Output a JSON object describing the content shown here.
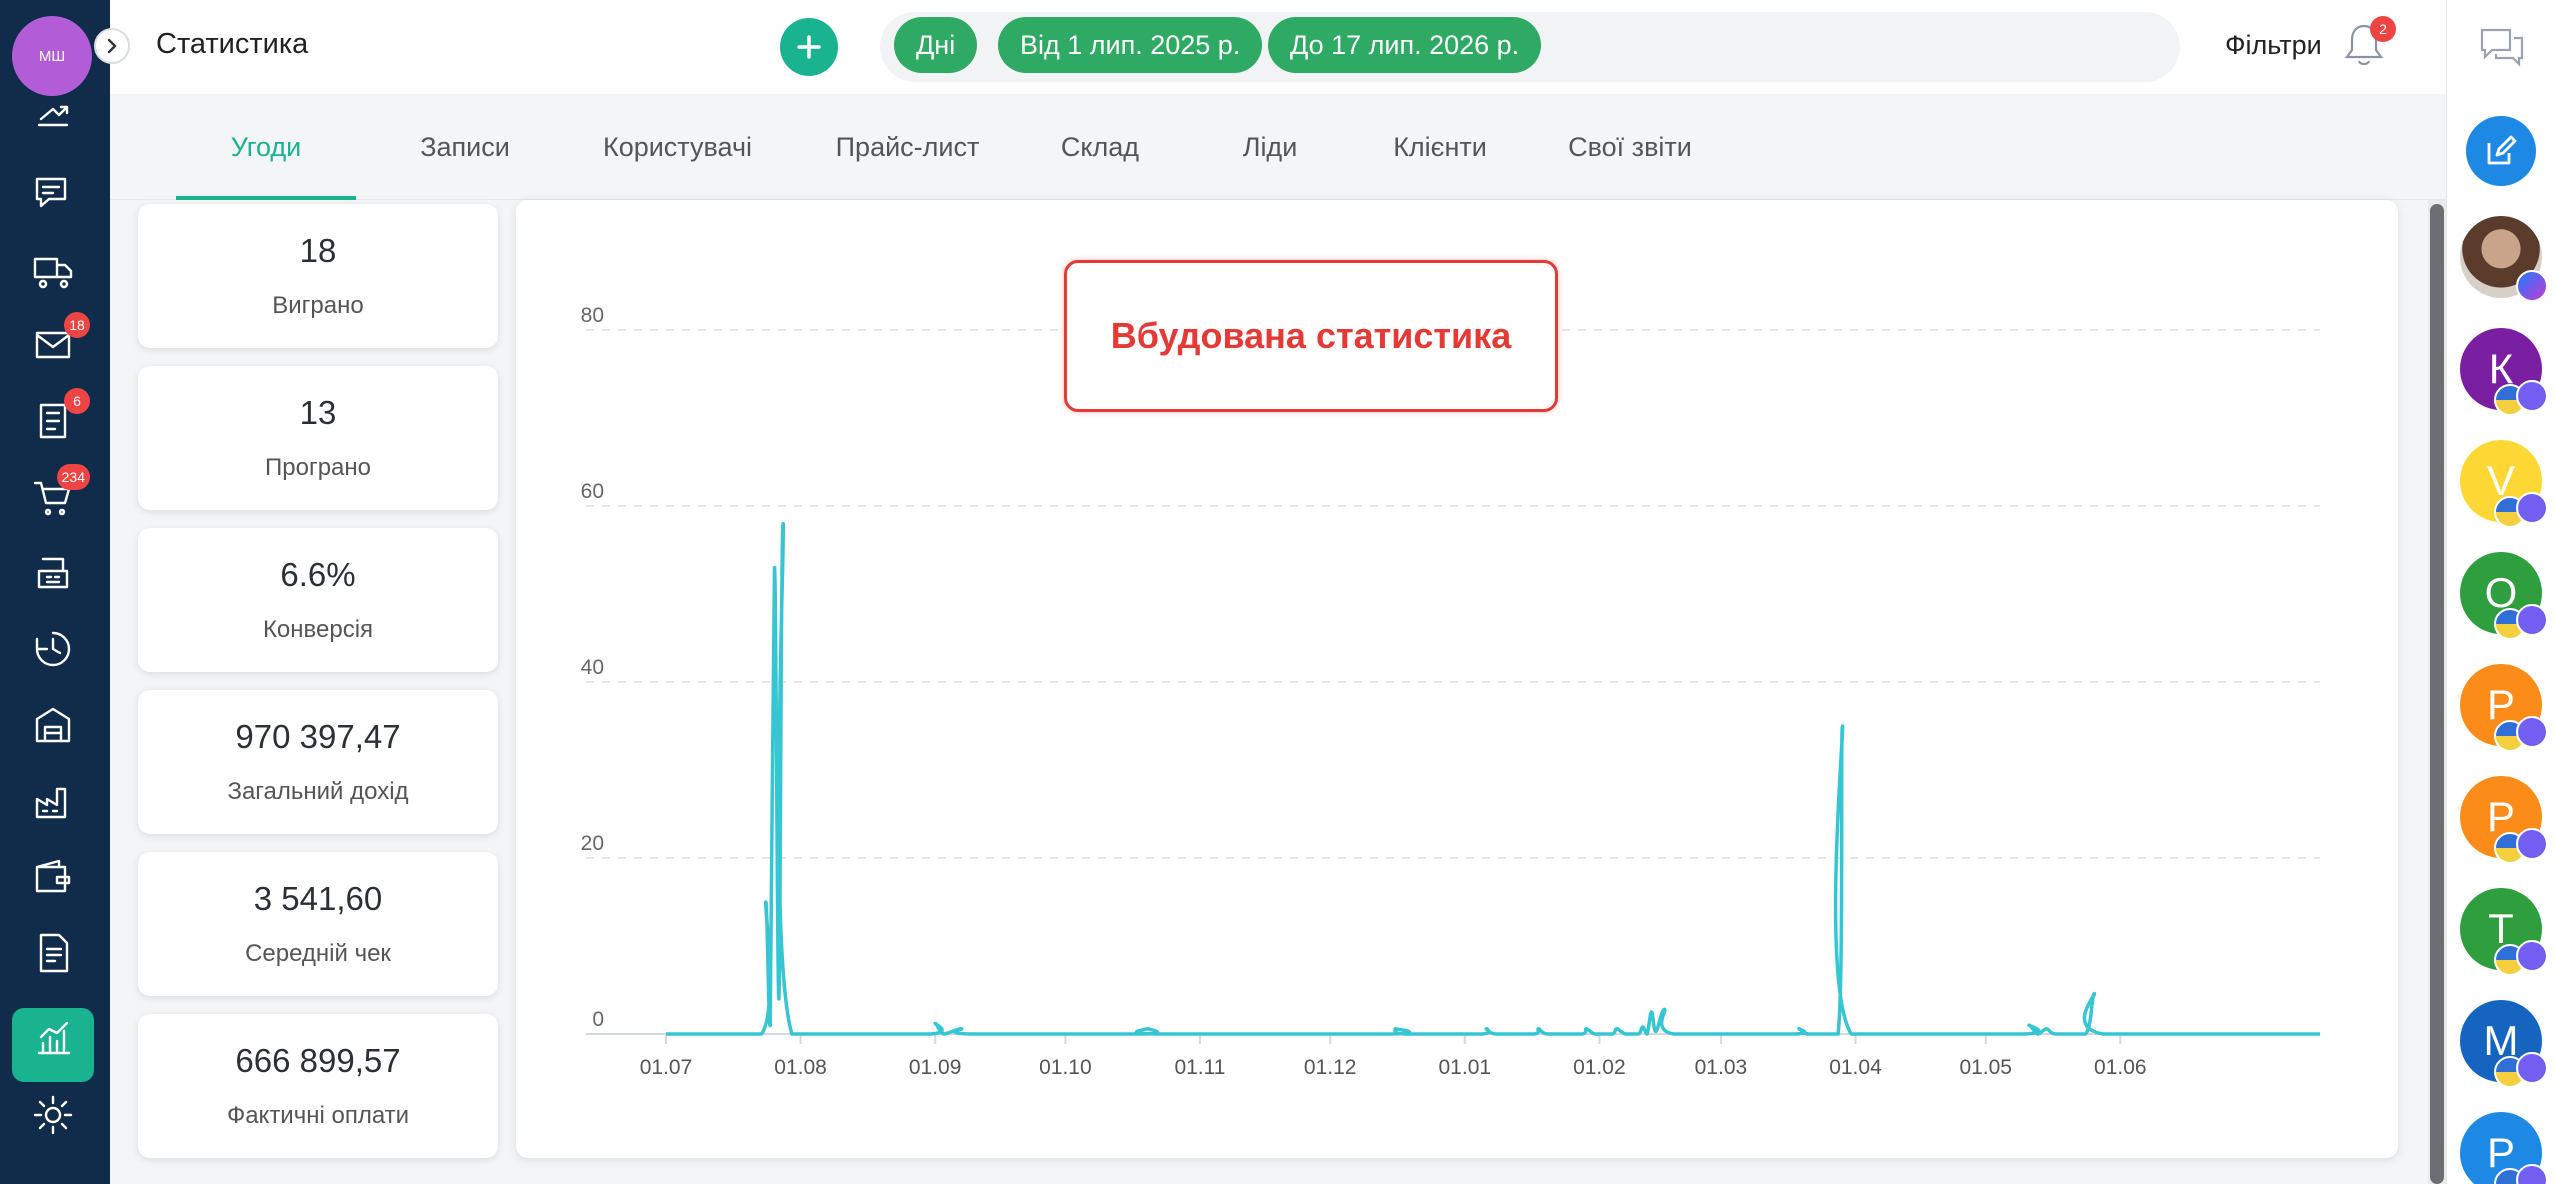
{
  "sidebar": {
    "user_initials": "МШ",
    "icons": [
      {
        "name": "payments-icon"
      },
      {
        "name": "chat-icon"
      },
      {
        "name": "delivery-truck-icon"
      },
      {
        "name": "mail-icon",
        "badge": "18"
      },
      {
        "name": "tasks-icon",
        "badge": "6"
      },
      {
        "name": "cart-icon",
        "badge": "234"
      },
      {
        "name": "cash-register-icon"
      },
      {
        "name": "history-clock-icon"
      },
      {
        "name": "warehouse-box-icon"
      },
      {
        "name": "factory-icon"
      },
      {
        "name": "wallet-icon"
      },
      {
        "name": "report-document-icon"
      },
      {
        "name": "statistics-chart-icon",
        "active": true
      },
      {
        "name": "settings-gear-icon"
      }
    ]
  },
  "header": {
    "title": "Статистика",
    "chips": {
      "period": "Дні",
      "from": "Від 1 лип. 2025 р.",
      "to": "До 17 лип. 2026 р."
    },
    "filters_label": "Фільтри",
    "notifications_count": "2"
  },
  "tabs": [
    {
      "label": "Угоди",
      "active": true
    },
    {
      "label": "Записи"
    },
    {
      "label": "Користувачі"
    },
    {
      "label": "Прайс-лист"
    },
    {
      "label": "Склад"
    },
    {
      "label": "Ліди"
    },
    {
      "label": "Клієнти"
    },
    {
      "label": "Свої звіти"
    }
  ],
  "stats": [
    {
      "value": "18",
      "label": "Виграно"
    },
    {
      "value": "13",
      "label": "Програно"
    },
    {
      "value": "6.6%",
      "label": "Конверсія"
    },
    {
      "value": "970 397,47",
      "label": "Загальний дохід"
    },
    {
      "value": "3 541,60",
      "label": "Середній чек"
    },
    {
      "value": "666 899,57",
      "label": "Фактичні оплати"
    }
  ],
  "callout": "Вбудована статистика",
  "chart_data": {
    "type": "line",
    "x_tick_labels": [
      "01.08",
      "01.09",
      "01.10",
      "01.11",
      "01.12",
      "01.01",
      "01.02",
      "01.03",
      "01.04",
      "01.05",
      "01.06",
      "01.07"
    ],
    "y_ticks": [
      0,
      20,
      40,
      60,
      80
    ],
    "ylim": [
      0,
      80
    ],
    "grid": true,
    "color": "#36c6d3",
    "series": [
      {
        "points": [
          [
            "2025-07-01",
            0
          ],
          [
            "2025-07-23",
            0
          ],
          [
            "2025-07-24",
            15
          ],
          [
            "2025-07-25",
            1
          ],
          [
            "2025-07-26",
            53
          ],
          [
            "2025-07-27",
            4
          ],
          [
            "2025-07-28",
            58
          ],
          [
            "2025-07-30",
            0
          ],
          [
            "2025-08-31",
            0
          ],
          [
            "2025-09-01",
            1.2
          ],
          [
            "2025-09-03",
            0
          ],
          [
            "2025-09-07",
            0.6
          ],
          [
            "2025-09-09",
            0
          ],
          [
            "2025-10-19",
            0
          ],
          [
            "2025-10-20",
            0.6
          ],
          [
            "2025-10-22",
            0
          ],
          [
            "2025-12-15",
            0
          ],
          [
            "2025-12-16",
            0.6
          ],
          [
            "2025-12-18",
            0
          ],
          [
            "2026-01-05",
            0
          ],
          [
            "2026-01-06",
            0.6
          ],
          [
            "2026-01-08",
            0
          ],
          [
            "2026-01-17",
            0
          ],
          [
            "2026-01-18",
            0.6
          ],
          [
            "2026-01-20",
            0
          ],
          [
            "2026-01-28",
            0
          ],
          [
            "2026-01-29",
            0.6
          ],
          [
            "2026-01-31",
            0
          ],
          [
            "2026-02-04",
            0
          ],
          [
            "2026-02-05",
            0.6
          ],
          [
            "2026-02-07",
            0
          ],
          [
            "2026-02-10",
            0
          ],
          [
            "2026-02-11",
            0.8
          ],
          [
            "2026-02-12",
            0
          ],
          [
            "2026-02-13",
            2.5
          ],
          [
            "2026-02-14",
            0.3
          ],
          [
            "2026-02-16",
            2.8
          ],
          [
            "2026-02-18",
            0
          ],
          [
            "2026-03-18",
            0
          ],
          [
            "2026-03-19",
            0.6
          ],
          [
            "2026-03-21",
            0
          ],
          [
            "2026-03-28",
            0
          ],
          [
            "2026-03-29",
            35
          ],
          [
            "2026-03-31",
            0
          ],
          [
            "2026-05-10",
            0
          ],
          [
            "2026-05-11",
            1
          ],
          [
            "2026-05-13",
            0
          ],
          [
            "2026-05-15",
            0.6
          ],
          [
            "2026-05-17",
            0
          ],
          [
            "2026-05-24",
            0
          ],
          [
            "2026-05-26",
            4.6
          ],
          [
            "2026-05-28",
            0
          ],
          [
            "2026-07-17",
            0
          ]
        ]
      }
    ]
  },
  "right_rail": {
    "contacts": [
      {
        "initial": "",
        "color": "#8d6e63",
        "photo": true,
        "channel": "messenger"
      },
      {
        "initial": "К",
        "color": "#7b1fa2",
        "channel": "viber"
      },
      {
        "initial": "V",
        "color": "#fdd835",
        "channel": "viber"
      },
      {
        "initial": "О",
        "color": "#2e9e3e",
        "channel": "viber"
      },
      {
        "initial": "Р",
        "color": "#fb8c1a",
        "channel": "viber"
      },
      {
        "initial": "Р",
        "color": "#fb8c1a",
        "channel": "viber"
      },
      {
        "initial": "Т",
        "color": "#2e9e3e",
        "channel": "viber"
      },
      {
        "initial": "М",
        "color": "#1565c0",
        "channel": "viber"
      },
      {
        "initial": "Р",
        "color": "#1e88e5",
        "channel": "viber"
      }
    ]
  }
}
